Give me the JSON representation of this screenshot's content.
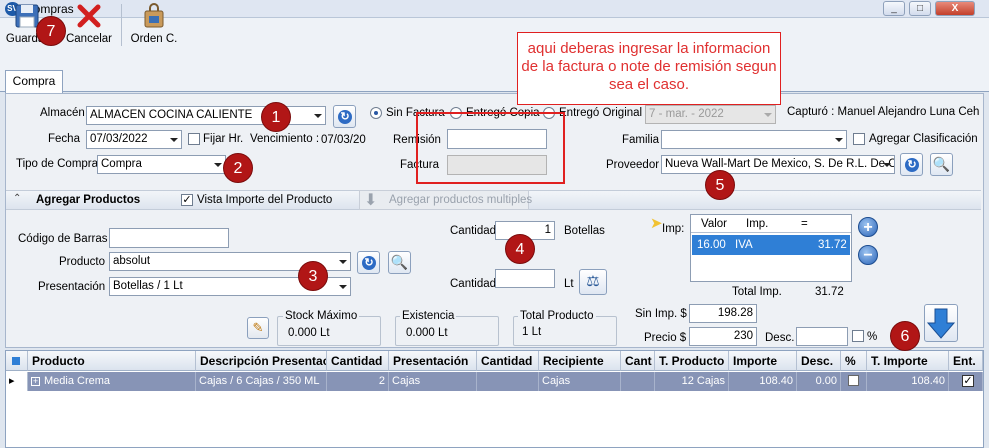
{
  "window": {
    "title": "Compras",
    "icon": "sv-app-icon",
    "controls": [
      "_",
      "□",
      "X"
    ]
  },
  "toolbar": {
    "save_label": "Guardar",
    "cancel_label": "Cancelar",
    "order_label": "Orden C."
  },
  "tabs": [
    {
      "label": "Compra"
    }
  ],
  "annotation": {
    "text": "aqui deberas ingresar la informacion de la factura o note de remisión segun sea el caso."
  },
  "badges": [
    "1",
    "2",
    "3",
    "4",
    "5",
    "6",
    "7"
  ],
  "form": {
    "almacen_label": "Almacén",
    "almacen_value": "ALMACEN COCINA CALIENTE",
    "fecha_label": "Fecha",
    "fecha_value": "07/03/2022",
    "fijar_hr_label": "Fijar Hr.",
    "vencimiento_label": "Vencimiento :",
    "vencimiento_value": "07/03/20",
    "tipo_label": "Tipo de Compra",
    "tipo_value": "Compra",
    "sin_factura": "Sin Factura",
    "entrego_copia": "Entregó Copia",
    "entrego_original": "Entregó Original",
    "date_disabled": "7 - mar. - 2022",
    "capturo": "Capturó : Manuel Alejandro  Luna Ceh",
    "remision_label": "Remisión",
    "factura_label": "Factura",
    "familia_label": "Familia",
    "agregar_clasificacion": "Agregar Clasificación",
    "proveedor_label": "Proveedor",
    "proveedor_value": "Nueva Wall-Mart De Mexico, S. De R.L. De C"
  },
  "products": {
    "section_title": "Agregar Productos",
    "vista_importe": "Vista Importe del Producto",
    "multiples": "Agregar productos multiples",
    "codigo_label": "Código de Barras",
    "producto_label": "Producto",
    "producto_value": "absolut",
    "presentacion_label": "Presentación",
    "presentacion_value": "Botellas / 1 Lt",
    "cantidad_label": "Cantidad",
    "cantidad_value": "1",
    "cantidad_unit": "Botellas",
    "cantidad2_label": "Cantidad",
    "cantidad2_unit": "Lt",
    "stock_label": "Stock Máximo",
    "stock_value": "0.000 Lt",
    "existencia_label": "Existencia",
    "existencia_value": "0.000 Lt",
    "total_label": "Total Producto",
    "total_value": "1 Lt",
    "imp_label": "Imp:",
    "imp_headers": [
      "Valor",
      "Imp.",
      "="
    ],
    "imp_row": [
      "16.00",
      "IVA",
      "31.72"
    ],
    "total_imp_label": "Total Imp.",
    "total_imp_value": "31.72",
    "sin_imp_label": "Sin Imp. $",
    "sin_imp_value": "198.28",
    "precio_label": "Precio $",
    "precio_value": "230",
    "desc_label": "Desc.",
    "pct_label": "%"
  },
  "grid": {
    "headers": [
      "Producto",
      "Descripción Presentación",
      "Cantidad",
      "Presentación",
      "Cantidad",
      "Recipiente",
      "Cant",
      "T. Producto",
      "Importe",
      "Desc.",
      "%",
      "T. Importe",
      "Ent."
    ],
    "rows": [
      {
        "producto": "Media Crema",
        "descripcion": "Cajas / 6 Cajas / 350 ML",
        "cantidad": "2",
        "presentacion": "Cajas",
        "cantidad2": "",
        "recipiente": "Cajas",
        "cant": "",
        "t_producto": "12 Cajas",
        "importe": "108.40",
        "desc": "0.00",
        "t_importe": "108.40"
      }
    ]
  }
}
